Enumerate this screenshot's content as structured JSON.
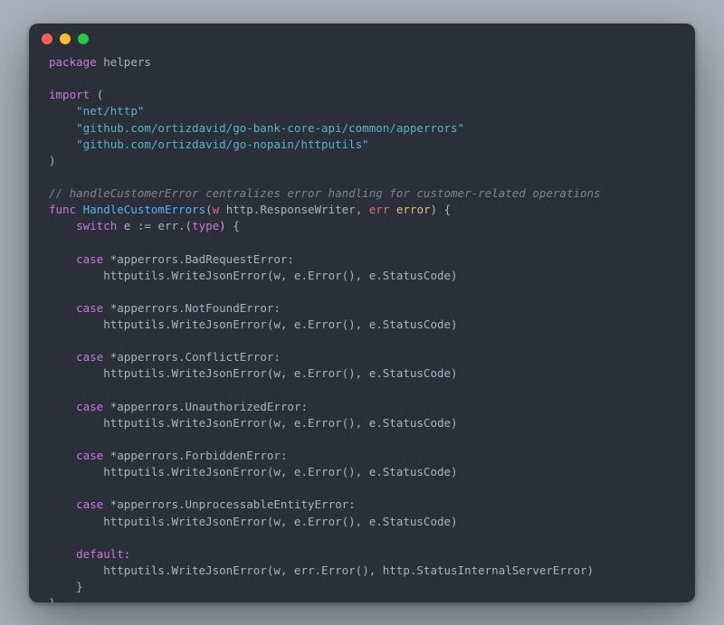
{
  "window": {
    "buttons": [
      "close",
      "minimize",
      "zoom"
    ]
  },
  "code": {
    "pkg_kw": "package",
    "pkg_name": "helpers",
    "import_kw": "import",
    "imports": [
      "\"net/http\"",
      "\"github.com/ortizdavid/go-bank-core-api/common/apperrors\"",
      "\"github.com/ortizdavid/go-nopain/httputils\""
    ],
    "comment": "// handleCustomerError centralizes error handling for customer-related operations",
    "func_kw": "func",
    "func_name": "HandleCustomErrors",
    "param_w": "w",
    "param_w_type": "http.ResponseWriter",
    "param_err": "err",
    "param_err_type": "error",
    "switch_kw": "switch",
    "switch_expr": "e := err.(",
    "type_kw": "type",
    "case_kw": "case",
    "default_kw": "default",
    "cases": [
      "*apperrors.BadRequestError",
      "*apperrors.NotFoundError",
      "*apperrors.ConflictError",
      "*apperrors.UnauthorizedError",
      "*apperrors.ForbiddenError",
      "*apperrors.UnprocessableEntityError"
    ],
    "call_line": "httputils.WriteJsonError(w, e.Error(), e.StatusCode)",
    "default_call": "httputils.WriteJsonError(w, err.Error(), http.StatusInternalServerError)"
  }
}
